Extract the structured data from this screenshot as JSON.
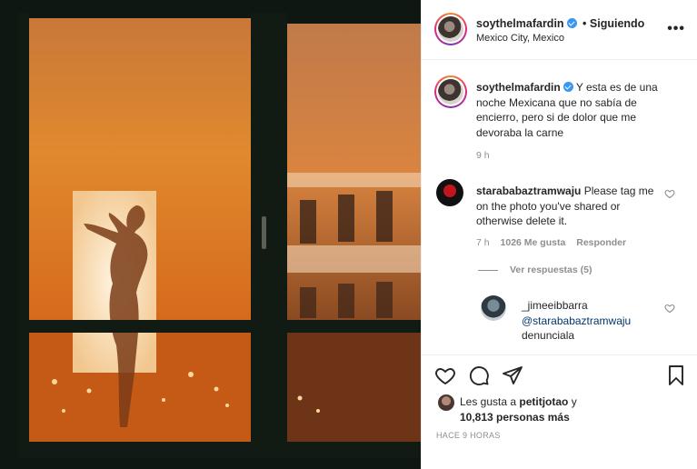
{
  "post": {
    "username": "soythelmafardin",
    "follow_status": "• Siguiendo",
    "location": "Mexico City, Mexico",
    "caption": "Y esta es de una noche Mexicana que no sabía de encierro, pero si de dolor que me devoraba la carne",
    "caption_time": "9 h",
    "time_ago": "HACE 9 HORAS"
  },
  "comments": [
    {
      "username": "starababaztramwaju",
      "text": "Please tag me on the photo you've shared or otherwise delete it.",
      "time": "7 h",
      "likes": "1026 Me gusta",
      "reply_label": "Responder",
      "view_replies": "Ver respuestas (5)"
    }
  ],
  "reply": {
    "username": "_jimeeibbarra",
    "mention": "@starababaztramwaju",
    "text": "denunciala"
  },
  "likes": {
    "prefix": "Les gusta a",
    "user": "petitjotao",
    "suffix": "y",
    "count": "10,813 personas más"
  },
  "icons": [
    "more-icon",
    "heart-icon",
    "comment-icon",
    "share-icon",
    "bookmark-icon",
    "verified-icon"
  ],
  "colors": {
    "verified": "#3897f0",
    "mention": "#00376b",
    "muted": "#8e8e8e",
    "text": "#262626"
  }
}
